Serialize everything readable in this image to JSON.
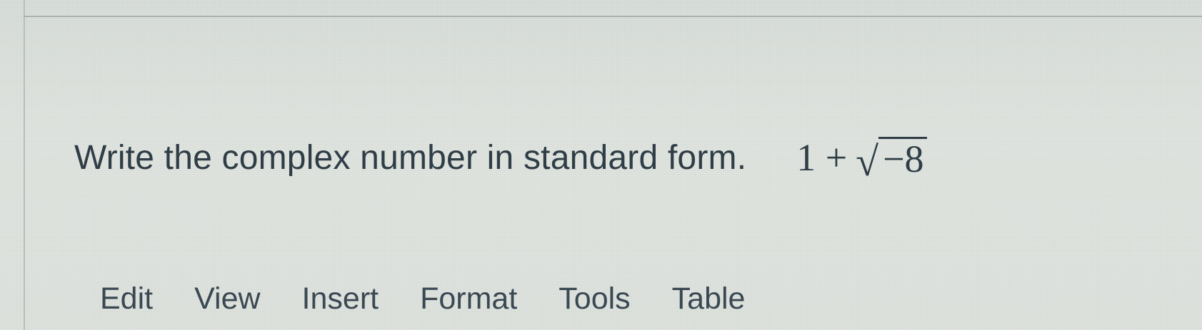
{
  "question": {
    "prompt": "Write the complex number in standard form.",
    "expression_lead": "1 +",
    "radical_symbol": "√",
    "radicand": "−8"
  },
  "editor_menu": {
    "items": [
      "Edit",
      "View",
      "Insert",
      "Format",
      "Tools",
      "Table"
    ]
  }
}
